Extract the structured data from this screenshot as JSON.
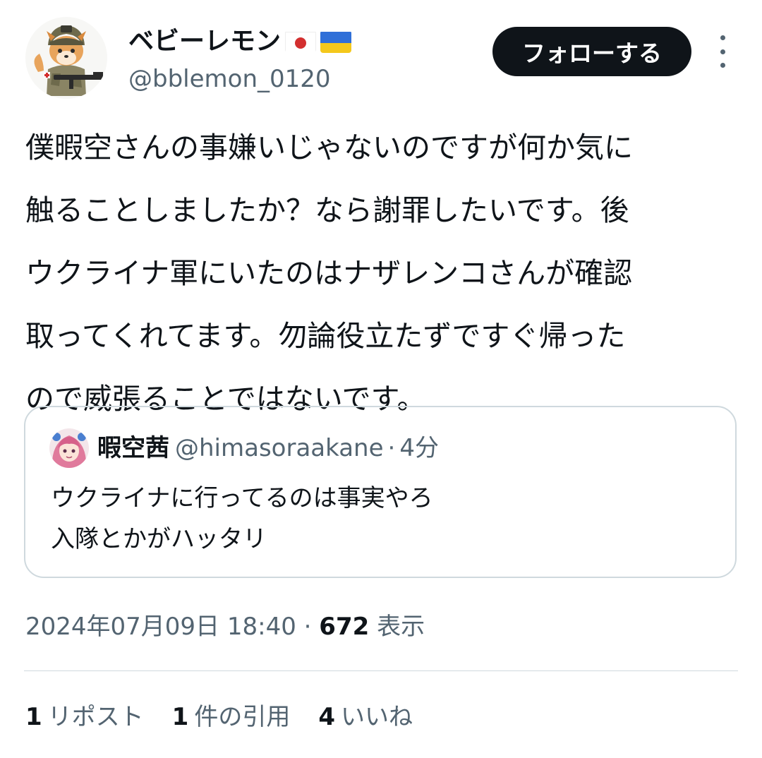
{
  "author": {
    "display_name": "ベビーレモン",
    "flags": [
      "japan-flag-icon",
      "ukraine-flag-icon"
    ],
    "handle": "@bblemon_0120",
    "avatar": "shiba-soldier-avatar"
  },
  "actions": {
    "follow_label": "フォローする",
    "more_icon": "more-vertical-icon"
  },
  "tweet": {
    "lines": [
      "僕暇空さんの事嫌いじゃないのですが何か気に",
      "触ることしましたか？なら謝罪したいです。後",
      "ウクライナ軍にいたのはナザレンコさんが確認",
      "取ってくれてます。勿論役立たずですぐ帰った",
      "ので威張ることではないです。"
    ]
  },
  "quote": {
    "avatar": "pink-hair-avatar",
    "name": "暇空茜",
    "handle": "@himasoraakane",
    "separator": "·",
    "time": "4分",
    "lines": [
      "ウクライナに行ってるのは事実やろ",
      "入隊とかがハッタリ"
    ]
  },
  "meta": {
    "timestamp": "2024年07月09日 18:40",
    "separator": "·",
    "views_count": "672",
    "views_label": "表示"
  },
  "stats": {
    "reposts_count": "1",
    "reposts_label": "リポスト",
    "quotes_count": "1",
    "quotes_label": "件の引用",
    "likes_count": "4",
    "likes_label": "いいね"
  },
  "colors": {
    "text": "#0f1419",
    "secondary": "#536471",
    "border": "#cfd9de",
    "button_bg": "#0f1419"
  }
}
